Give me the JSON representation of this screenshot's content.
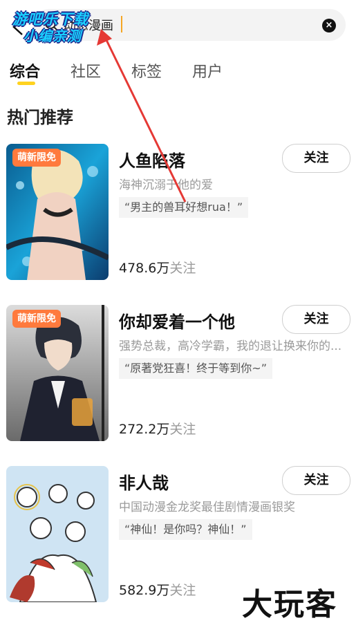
{
  "search": {
    "value": "动态漫画",
    "back_icon": "back-arrow-icon",
    "search_icon": "search-icon",
    "clear_icon": "clear-icon"
  },
  "watermark": {
    "line1": "游吧乐下载",
    "line2": "小编亲测"
  },
  "tabs": [
    {
      "label": "综合",
      "active": true
    },
    {
      "label": "社区"
    },
    {
      "label": "标签"
    },
    {
      "label": "用户"
    }
  ],
  "section_title": "热门推荐",
  "follow_label": "关注",
  "items": [
    {
      "badge": "萌新限免",
      "title": "人鱼陷落",
      "desc": "海神沉溺于他的爱",
      "quote": "“男主的兽耳好想rua！”",
      "count": "478.6万",
      "unit": "关注"
    },
    {
      "badge": "萌新限免",
      "title": "你却爱着一个他",
      "desc": "强势总裁，高冷学霸，我的退让换来你的...",
      "quote": "“原著党狂喜！终于等到你~”",
      "count": "272.2万",
      "unit": "关注"
    },
    {
      "title": "非人哉",
      "desc": "中国动漫金龙奖最佳剧情漫画银奖",
      "quote": "“神仙！是你吗？神仙！”",
      "count": "582.9万",
      "unit": "关注"
    }
  ],
  "brand_logo": "大玩客",
  "colors": {
    "accent": "#ffd21f",
    "badge": "#ff7a3d",
    "arrow": "#e53935",
    "caret": "#f5a623"
  }
}
